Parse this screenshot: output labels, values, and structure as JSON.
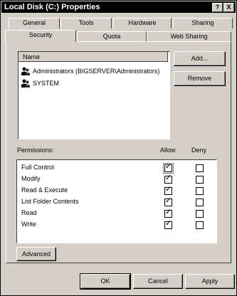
{
  "window": {
    "title": "Local Disk (C:) Properties",
    "help_button": "?",
    "close_button": "X"
  },
  "tabs": {
    "row_back": [
      "General",
      "Tools",
      "Hardware",
      "Sharing"
    ],
    "row_front": [
      "Security",
      "Quota",
      "Web Sharing"
    ],
    "active": "Security"
  },
  "users": {
    "header": "Name",
    "items": [
      "Administrators (BIGSERVER\\Administrators)",
      "SYSTEM"
    ]
  },
  "buttons": {
    "add": "Add...",
    "remove": "Remove",
    "advanced": "Advanced",
    "ok": "OK",
    "cancel": "Cancel",
    "apply": "Apply"
  },
  "permissions": {
    "label": "Permissions:",
    "allow_header": "Allow",
    "deny_header": "Deny",
    "rows": [
      {
        "name": "Full Control",
        "allow": true,
        "deny": false
      },
      {
        "name": "Modify",
        "allow": true,
        "deny": false
      },
      {
        "name": "Read & Execute",
        "allow": true,
        "deny": false
      },
      {
        "name": "List Folder Contents",
        "allow": true,
        "deny": false
      },
      {
        "name": "Read",
        "allow": true,
        "deny": false
      },
      {
        "name": "Write",
        "allow": true,
        "deny": false
      }
    ]
  },
  "check_glyph": "✓"
}
